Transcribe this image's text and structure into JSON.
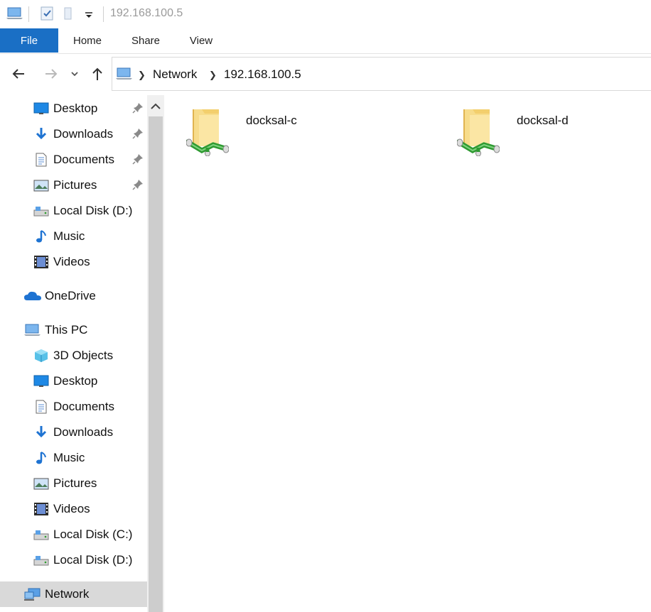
{
  "window": {
    "title": "192.168.100.5"
  },
  "quick_access_toolbar": {
    "items": [
      "computer-icon",
      "properties-check-icon",
      "new-folder-icon",
      "customize-dropdown-icon"
    ]
  },
  "ribbon": {
    "tabs": [
      {
        "label": "File",
        "active": true
      },
      {
        "label": "Home"
      },
      {
        "label": "Share"
      },
      {
        "label": "View"
      }
    ]
  },
  "address_bar": {
    "crumbs": [
      "Network",
      "192.168.100.5"
    ]
  },
  "sidebar": {
    "quick_access": [
      {
        "label": "Desktop",
        "icon": "desktop-icon",
        "pinned": true
      },
      {
        "label": "Downloads",
        "icon": "downloads-icon",
        "pinned": true
      },
      {
        "label": "Documents",
        "icon": "documents-icon",
        "pinned": true
      },
      {
        "label": "Pictures",
        "icon": "pictures-icon",
        "pinned": true
      },
      {
        "label": "Local Disk (D:)",
        "icon": "local-disk-icon",
        "pinned": false
      },
      {
        "label": "Music",
        "icon": "music-icon",
        "pinned": false
      },
      {
        "label": "Videos",
        "icon": "videos-icon",
        "pinned": false
      }
    ],
    "onedrive": {
      "label": "OneDrive",
      "icon": "onedrive-icon"
    },
    "this_pc": {
      "label": "This PC",
      "icon": "this-pc-icon"
    },
    "this_pc_items": [
      {
        "label": "3D Objects",
        "icon": "3d-objects-icon"
      },
      {
        "label": "Desktop",
        "icon": "desktop-icon"
      },
      {
        "label": "Documents",
        "icon": "documents-icon"
      },
      {
        "label": "Downloads",
        "icon": "downloads-icon"
      },
      {
        "label": "Music",
        "icon": "music-icon"
      },
      {
        "label": "Pictures",
        "icon": "pictures-icon"
      },
      {
        "label": "Videos",
        "icon": "videos-icon"
      },
      {
        "label": "Local Disk (C:)",
        "icon": "local-disk-icon"
      },
      {
        "label": "Local Disk (D:)",
        "icon": "local-disk-icon"
      }
    ],
    "network": {
      "label": "Network",
      "icon": "network-icon",
      "selected": true
    }
  },
  "content": {
    "items": [
      {
        "name": "docksal-c",
        "icon": "network-share-folder-icon"
      },
      {
        "name": "docksal-d",
        "icon": "network-share-folder-icon"
      }
    ]
  },
  "colors": {
    "accent": "#1a6fc5",
    "selection": "#d9d9d9",
    "folder": "#f5d67a",
    "share_pipe": "#3fae3f"
  }
}
